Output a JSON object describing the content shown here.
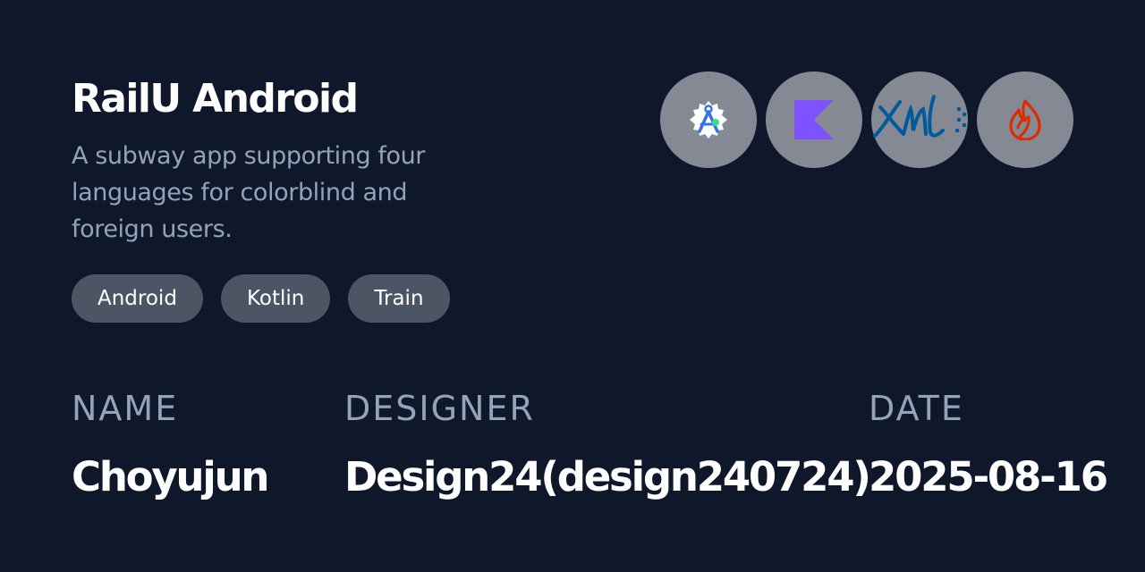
{
  "project": {
    "title": "RailU Android",
    "description": "A subway app supporting four languages for colorblind and foreign users.",
    "tags": [
      "Android",
      "Kotlin",
      "Train"
    ]
  },
  "tech_icons": [
    {
      "name": "android-studio-icon",
      "color": "#3870e8"
    },
    {
      "name": "kotlin-icon",
      "color": "#7f52ff"
    },
    {
      "name": "xml-icon",
      "color": "#005a9c"
    },
    {
      "name": "firebase-icon",
      "color": "#dd2c00"
    }
  ],
  "meta": {
    "name_label": "NAME",
    "name_value": "Choyujun",
    "designer_label": "DESIGNER",
    "designer_value": "Design24(design240724)",
    "date_label": "DATE",
    "date_value": "2025-08-16"
  },
  "colors": {
    "background": "#0f172a",
    "muted_text": "#94a3b8",
    "tag_background": "#4b5563",
    "icon_circle": "#858993"
  }
}
